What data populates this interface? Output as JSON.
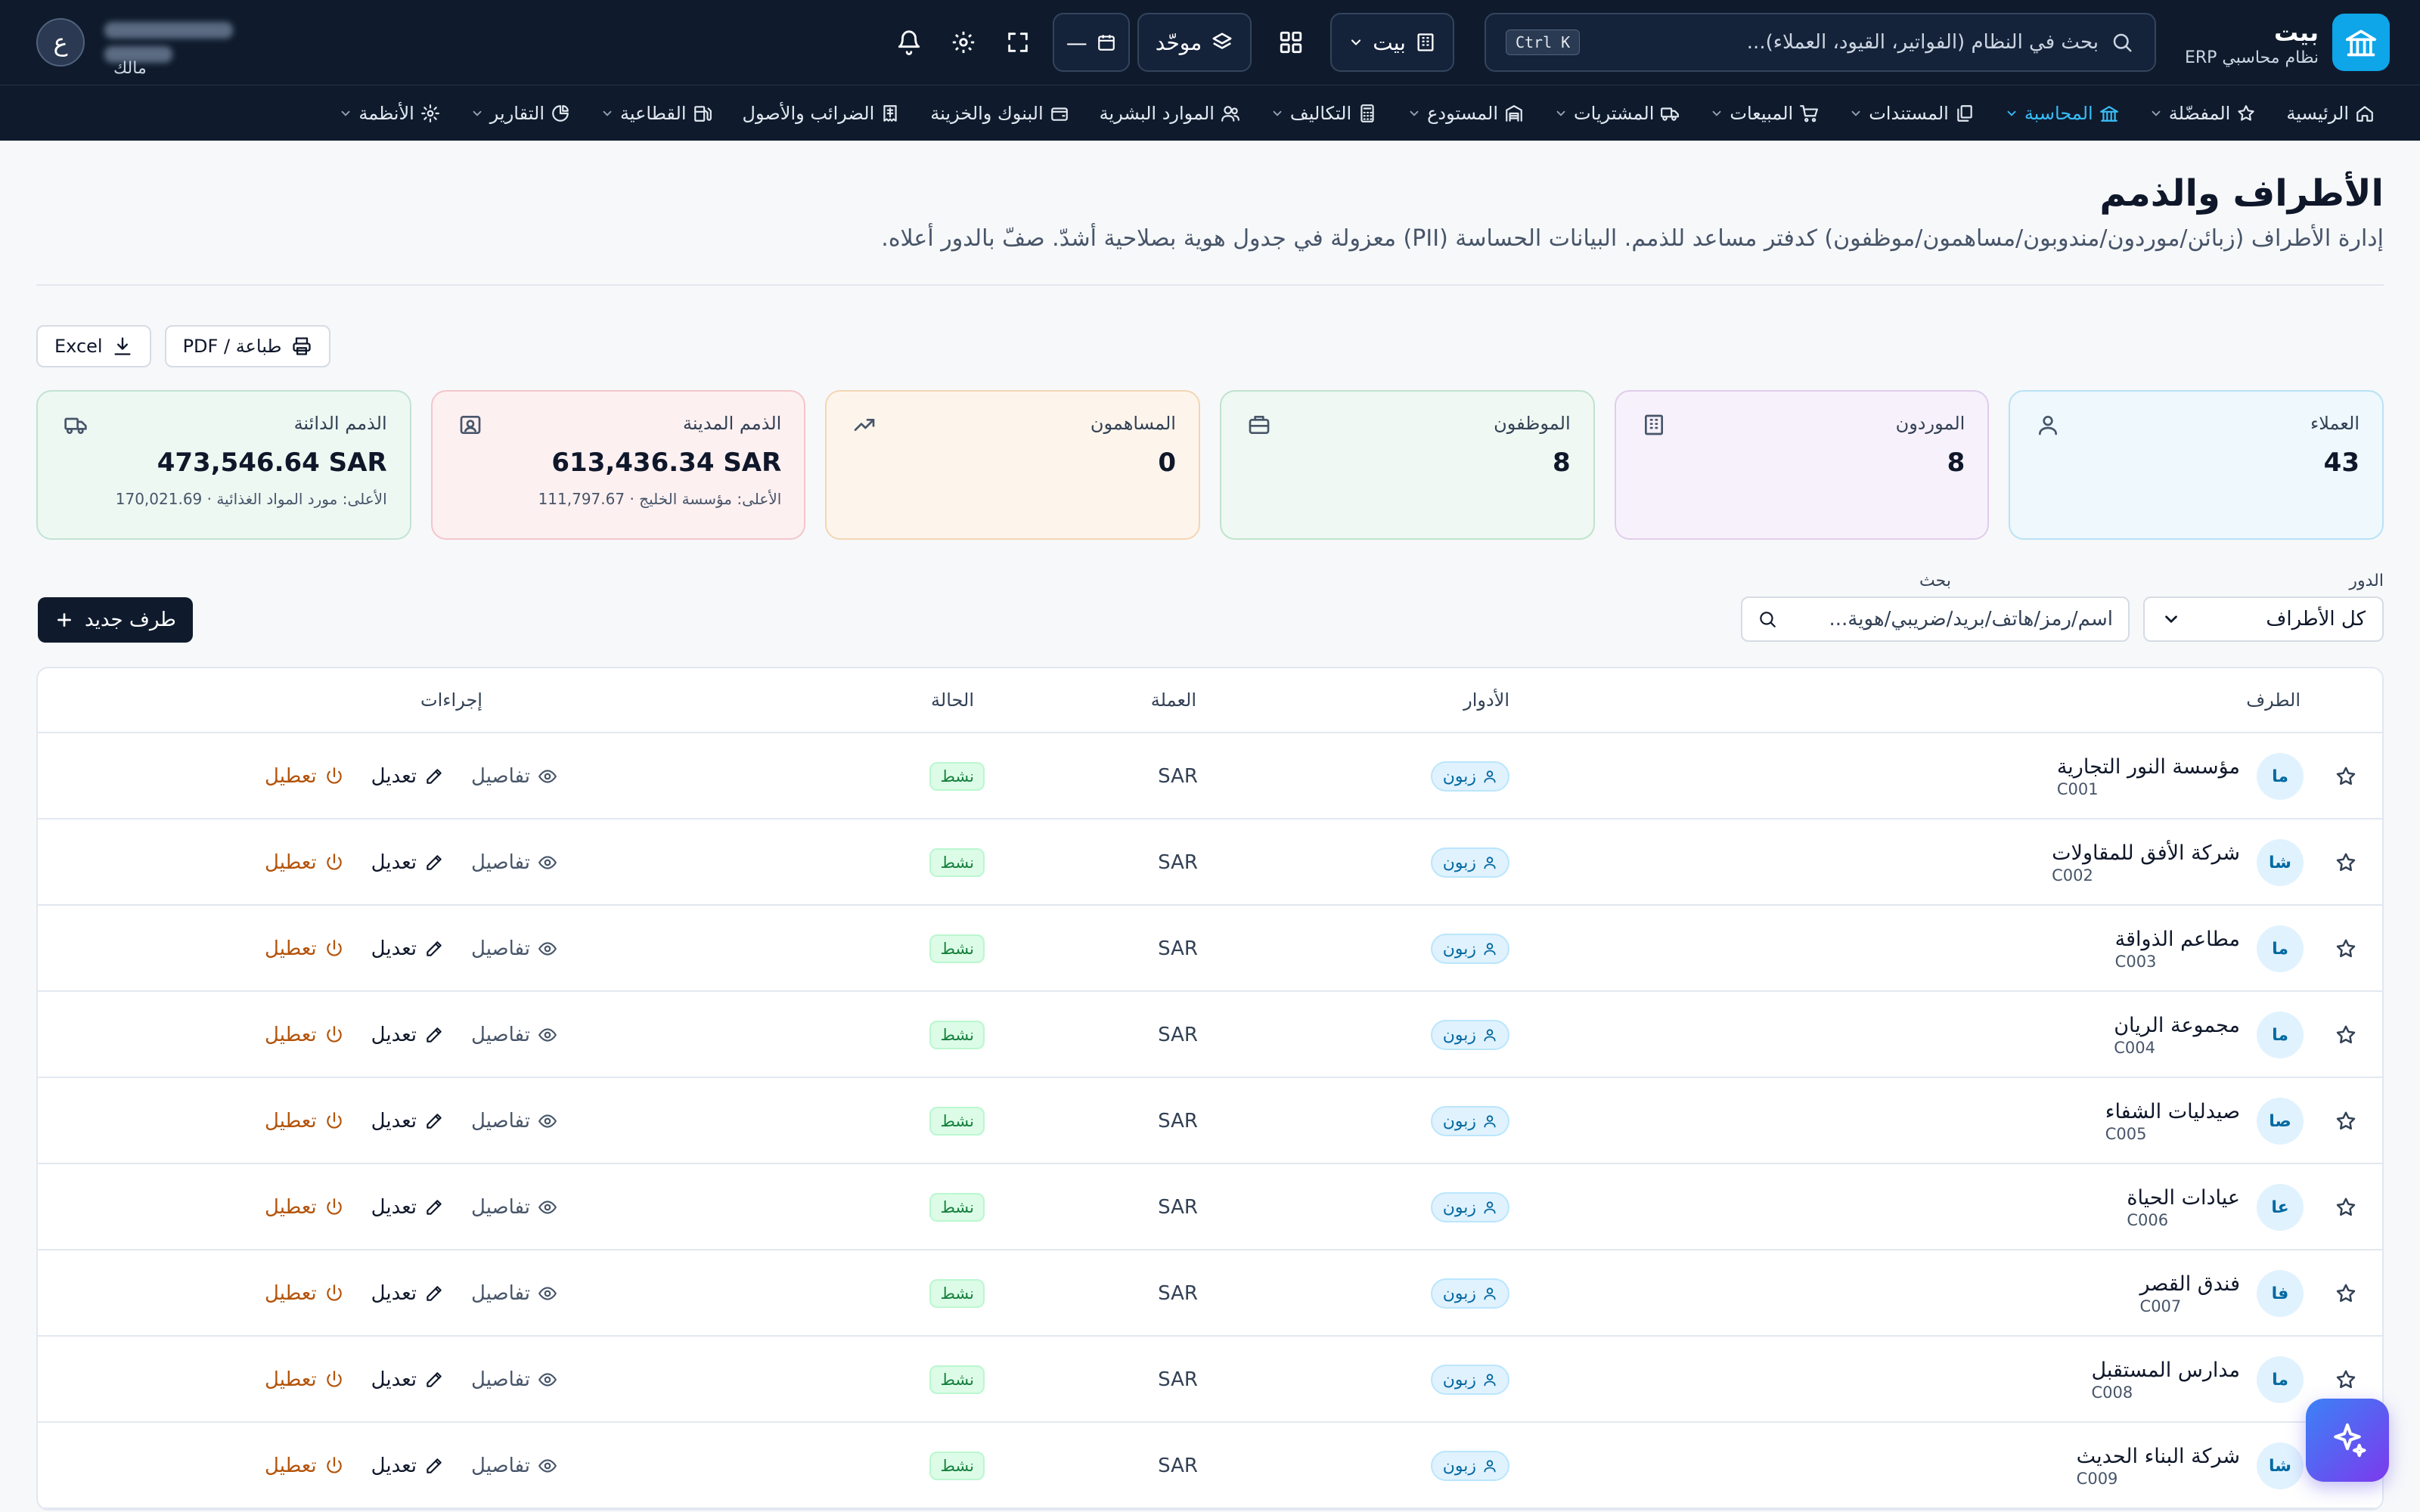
{
  "brand": {
    "name": "بيت",
    "subtitle": "نظام محاسبي ERP"
  },
  "search": {
    "placeholder": "بحث في النظام (الفواتير، القيود، العملاء)...",
    "shortcut": "Ctrl K"
  },
  "topbar": {
    "org_label": "بيت",
    "view_label": "موحّد",
    "date_label": "—",
    "user_initial": "ع",
    "user_role": "مالك"
  },
  "nav": [
    {
      "label": "الرئيسية",
      "icon": "home-icon",
      "chevron": false,
      "active": false
    },
    {
      "label": "المفضّلة",
      "icon": "star-icon",
      "chevron": true,
      "active": false
    },
    {
      "label": "المحاسبة",
      "icon": "bank-icon",
      "chevron": true,
      "active": true
    },
    {
      "label": "المستندات",
      "icon": "documents-icon",
      "chevron": true,
      "active": false
    },
    {
      "label": "المبيعات",
      "icon": "cart-icon",
      "chevron": true,
      "active": false
    },
    {
      "label": "المشتريات",
      "icon": "truck-icon",
      "chevron": true,
      "active": false
    },
    {
      "label": "المستودع",
      "icon": "warehouse-icon",
      "chevron": true,
      "active": false
    },
    {
      "label": "التكاليف",
      "icon": "calculator-icon",
      "chevron": true,
      "active": false
    },
    {
      "label": "الموارد البشرية",
      "icon": "users-icon",
      "chevron": false,
      "active": false
    },
    {
      "label": "البنوك والخزينة",
      "icon": "wallet-icon",
      "chevron": false,
      "active": false
    },
    {
      "label": "الضرائب والأصول",
      "icon": "receipt-icon",
      "chevron": false,
      "active": false
    },
    {
      "label": "القطاعية",
      "icon": "fuel-icon",
      "chevron": true,
      "active": false
    },
    {
      "label": "التقارير",
      "icon": "chart-pie-icon",
      "chevron": true,
      "active": false
    },
    {
      "label": "الأنظمة",
      "icon": "gear-icon",
      "chevron": true,
      "active": false
    }
  ],
  "page": {
    "title": "الأطراف والذمم",
    "description": "إدارة الأطراف (زبائن/موردون/مندوبون/مساهمون/موظفون) كدفتر مساعد للذمم. البيانات الحساسة (PII) معزولة في جدول هوية بصلاحية أشدّ. صفّ بالدور أعلاه."
  },
  "exports": {
    "excel": "Excel",
    "print": "طباعة / PDF"
  },
  "stats": [
    {
      "label": "العملاء",
      "value": "43",
      "sub": "",
      "icon": "user-icon",
      "bg": "#eef8fd",
      "border": "#b9e2f5"
    },
    {
      "label": "الموردون",
      "value": "8",
      "sub": "",
      "icon": "building-icon",
      "bg": "#f7f1fb",
      "border": "#e0cdeb"
    },
    {
      "label": "الموظفون",
      "value": "8",
      "sub": "",
      "icon": "briefcase-icon",
      "bg": "#eff8f2",
      "border": "#bfe3cd"
    },
    {
      "label": "المساهمون",
      "value": "0",
      "sub": "",
      "icon": "trending-up-icon",
      "bg": "#fdf5ec",
      "border": "#f2d6b4"
    },
    {
      "label": "الذمم المدينة",
      "value": "613,436.34 SAR",
      "sub": "الأعلى: مؤسسة الخليج · 111,797.67",
      "icon": "id-card-icon",
      "bg": "#fdf0f1",
      "border": "#f3c6cb"
    },
    {
      "label": "الذمم الدائنة",
      "value": "473,546.64 SAR",
      "sub": "الأعلى: مورد المواد الغذائية · 170,021.69",
      "icon": "truck-icon",
      "bg": "#eef8f3",
      "border": "#c2e3d2"
    }
  ],
  "filters": {
    "role_label": "الدور",
    "role_value": "كل الأطراف",
    "search_label": "بحث",
    "search_placeholder": "اسم/رمز/هاتف/بريد/ضريبي/هوية..."
  },
  "new_button": "طرف جديد",
  "table": {
    "headers": {
      "party": "الطرف",
      "roles": "الأدوار",
      "currency": "العملة",
      "status": "الحالة",
      "actions": "إجراءات"
    },
    "action_labels": {
      "details": "تفاصيل",
      "edit": "تعديل",
      "disable": "تعطيل"
    },
    "rows": [
      {
        "initials": "ما",
        "name": "مؤسسة النور التجارية",
        "code": "C001",
        "role": "زبون",
        "currency": "SAR",
        "status": "نشط"
      },
      {
        "initials": "شا",
        "name": "شركة الأفق للمقاولات",
        "code": "C002",
        "role": "زبون",
        "currency": "SAR",
        "status": "نشط"
      },
      {
        "initials": "ما",
        "name": "مطاعم الذواقة",
        "code": "C003",
        "role": "زبون",
        "currency": "SAR",
        "status": "نشط"
      },
      {
        "initials": "ما",
        "name": "مجموعة الريان",
        "code": "C004",
        "role": "زبون",
        "currency": "SAR",
        "status": "نشط"
      },
      {
        "initials": "صا",
        "name": "صيدليات الشفاء",
        "code": "C005",
        "role": "زبون",
        "currency": "SAR",
        "status": "نشط"
      },
      {
        "initials": "عا",
        "name": "عيادات الحياة",
        "code": "C006",
        "role": "زبون",
        "currency": "SAR",
        "status": "نشط"
      },
      {
        "initials": "فا",
        "name": "فندق القصر",
        "code": "C007",
        "role": "زبون",
        "currency": "SAR",
        "status": "نشط"
      },
      {
        "initials": "ما",
        "name": "مدارس المستقبل",
        "code": "C008",
        "role": "زبون",
        "currency": "SAR",
        "status": "نشط"
      },
      {
        "initials": "شا",
        "name": "شركة البناء الحديث",
        "code": "C009",
        "role": "زبون",
        "currency": "SAR",
        "status": "نشط"
      }
    ]
  },
  "fab": {
    "icon": "sparkles-icon"
  }
}
